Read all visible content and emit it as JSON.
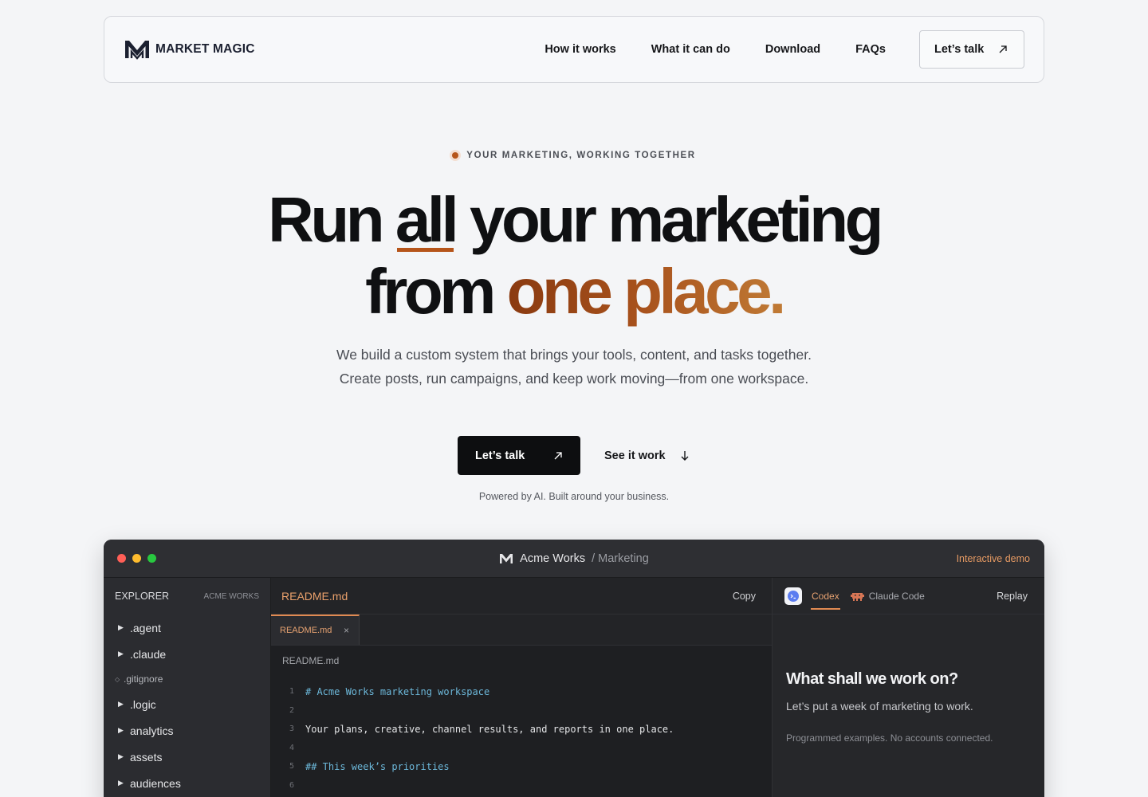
{
  "nav": {
    "logo_text": "MARKET MAGIC",
    "links": [
      "How it works",
      "What it can do",
      "Download",
      "FAQs"
    ],
    "cta_label": "Let’s talk"
  },
  "hero": {
    "eyebrow": "YOUR MARKETING, WORKING TOGETHER",
    "headline_line1_a": "Run",
    "headline_line1_b": "all",
    "headline_line1_c": "your marketing",
    "headline_line2_a": "from",
    "headline_line2_b": "one place.",
    "subcopy": "We build a custom system that brings your tools, content, and tasks together. Create posts, run campaigns, and keep work moving—from one workspace.",
    "primary_cta": "Let’s talk",
    "secondary_cta": "See it work",
    "powered": "Powered by AI. Built around your business."
  },
  "demo": {
    "window_title": "Acme Works",
    "window_subtitle": "/ Marketing",
    "badge": "Interactive demo",
    "explorer": {
      "title": "EXPLORER",
      "subtitle": "ACME WORKS",
      "items": [
        {
          "label": ".agent",
          "type": "folder"
        },
        {
          "label": ".claude",
          "type": "folder"
        },
        {
          "label": ".gitignore",
          "type": "file"
        },
        {
          "label": ".logic",
          "type": "folder"
        },
        {
          "label": "analytics",
          "type": "folder"
        },
        {
          "label": "assets",
          "type": "folder"
        },
        {
          "label": "audiences",
          "type": "folder"
        }
      ]
    },
    "editor": {
      "title": "README.md",
      "copy_label": "Copy",
      "tab_label": "README.md",
      "crumb": "README.md",
      "lines": [
        {
          "n": "1",
          "text": "# Acme Works marketing workspace",
          "heading": true
        },
        {
          "n": "2",
          "text": "",
          "heading": false
        },
        {
          "n": "3",
          "text": "Your plans, creative, channel results, and reports in one place.",
          "heading": false
        },
        {
          "n": "4",
          "text": "",
          "heading": false
        },
        {
          "n": "5",
          "text": "## This week’s priorities",
          "heading": true
        },
        {
          "n": "6",
          "text": "",
          "heading": false
        }
      ]
    },
    "agent": {
      "tab_active": "Codex",
      "tab_inactive": "Claude Code",
      "replay_label": "Replay",
      "heading": "What shall we work on?",
      "prompt": "Let’s put a week of marketing to work.",
      "note": "Programmed examples. No accounts connected."
    }
  },
  "colors": {
    "accent": "#b6551a",
    "dark": "#0d0e10",
    "background": "#f4f5f7"
  }
}
